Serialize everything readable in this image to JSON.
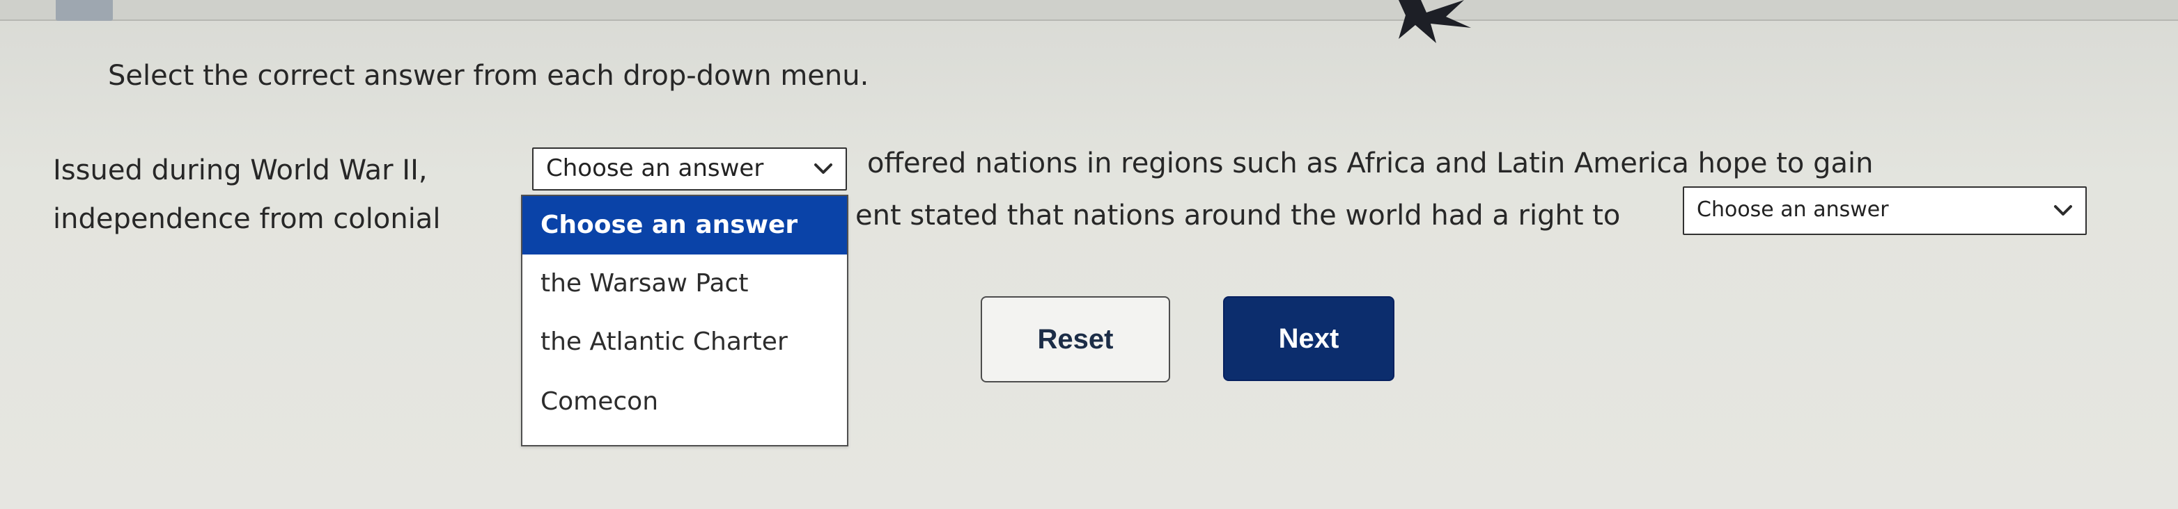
{
  "header": {
    "decorative": "top strip"
  },
  "question": {
    "instruction": "Select the correct answer from each drop-down menu.",
    "line1_before": "Issued during World War II,",
    "line1_after": "offered nations in regions such as Africa and Latin America hope to gain",
    "line2_before": "independence from colonial",
    "line2_after": "ent stated that nations around the world had a right to"
  },
  "dropdowns": {
    "first": {
      "selected": "Choose an answer",
      "options": [
        "Choose an answer",
        "the Warsaw Pact",
        "the Atlantic Charter",
        "Comecon"
      ]
    },
    "second": {
      "selected": "Choose an answer"
    }
  },
  "buttons": {
    "reset": "Reset",
    "next": "Next"
  },
  "colors": {
    "selected_option_bg": "#0a43a8",
    "next_button_bg": "#0c2d6d"
  },
  "icons": {
    "chevron": "chevron-down-icon",
    "cursor": "cursor-icon"
  }
}
